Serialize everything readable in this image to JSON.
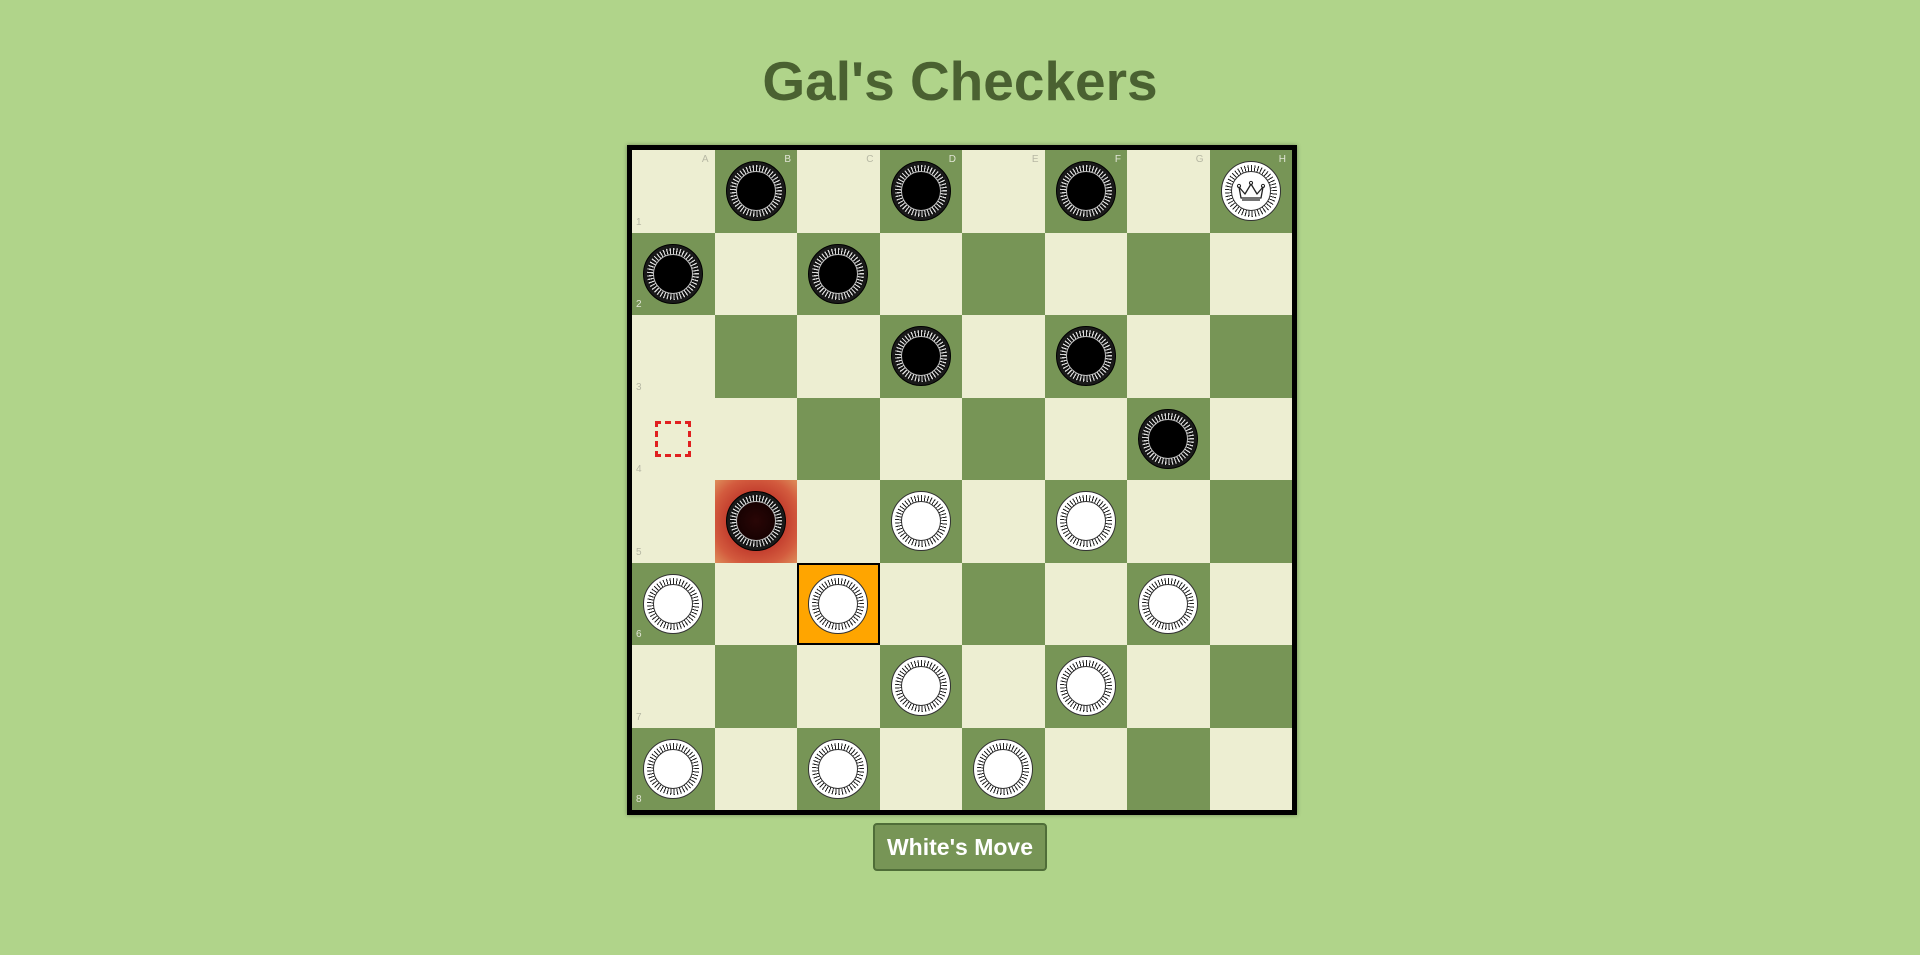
{
  "title": "Gal's Checkers",
  "turn_button_label": "White's Move",
  "board": {
    "files": [
      "A",
      "B",
      "C",
      "D",
      "E",
      "F",
      "G",
      "H"
    ],
    "ranks": [
      "1",
      "2",
      "3",
      "4",
      "5",
      "6",
      "7",
      "8"
    ],
    "squares": [
      [
        "light",
        "dark",
        "light",
        "dark",
        "light",
        "dark",
        "light",
        "dark"
      ],
      [
        "dark",
        "light",
        "dark",
        "light",
        "dark",
        "light",
        "dark",
        "light"
      ],
      [
        "light",
        "dark",
        "light",
        "dark",
        "light",
        "dark",
        "light",
        "dark"
      ],
      [
        "light",
        "light",
        "dark",
        "light",
        "dark",
        "light",
        "dark",
        "light"
      ],
      [
        "light",
        "dark",
        "light",
        "dark",
        "light",
        "dark",
        "light",
        "dark"
      ],
      [
        "dark",
        "light",
        "dark",
        "light",
        "dark",
        "light",
        "dark",
        "light"
      ],
      [
        "light",
        "dark",
        "light",
        "dark",
        "light",
        "dark",
        "light",
        "dark"
      ],
      [
        "dark",
        "light",
        "dark",
        "light",
        "dark",
        "light",
        "dark",
        "light"
      ]
    ],
    "pieces": [
      {
        "square": "B1",
        "color": "black",
        "king": false
      },
      {
        "square": "D1",
        "color": "black",
        "king": false
      },
      {
        "square": "F1",
        "color": "black",
        "king": false
      },
      {
        "square": "H1",
        "color": "white",
        "king": true
      },
      {
        "square": "A2",
        "color": "black",
        "king": false
      },
      {
        "square": "C2",
        "color": "black",
        "king": false
      },
      {
        "square": "D3",
        "color": "black",
        "king": false
      },
      {
        "square": "F3",
        "color": "black",
        "king": false
      },
      {
        "square": "G4",
        "color": "black",
        "king": false
      },
      {
        "square": "B5",
        "color": "black",
        "king": false,
        "threatened": true
      },
      {
        "square": "D5",
        "color": "white",
        "king": false
      },
      {
        "square": "F5",
        "color": "white",
        "king": false
      },
      {
        "square": "A6",
        "color": "white",
        "king": false
      },
      {
        "square": "C6",
        "color": "white",
        "king": false
      },
      {
        "square": "G6",
        "color": "white",
        "king": false
      },
      {
        "square": "D7",
        "color": "white",
        "king": false
      },
      {
        "square": "F7",
        "color": "white",
        "king": false
      },
      {
        "square": "A8",
        "color": "white",
        "king": false
      },
      {
        "square": "C8",
        "color": "white",
        "king": false
      },
      {
        "square": "E8",
        "color": "white",
        "king": false
      }
    ],
    "selected_square": "C6",
    "threat_square": "B5",
    "move_target_square": "A4"
  },
  "colors": {
    "background": "#b0d48a",
    "light_square": "#edeed2",
    "dark_square": "#779556",
    "selected": "#ffa500",
    "threat": "#c0392b",
    "target_marker": "#e02020",
    "title": "#4a6131"
  }
}
